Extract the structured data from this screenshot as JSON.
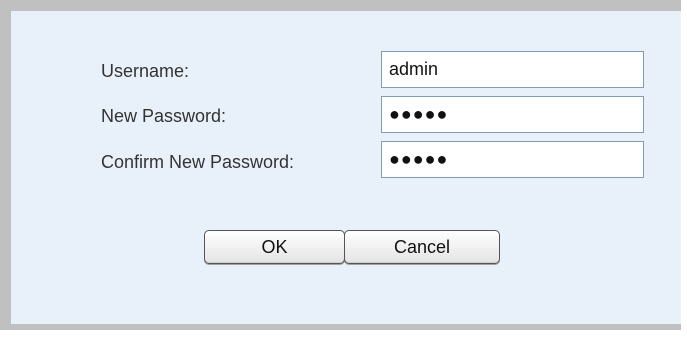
{
  "form": {
    "username_label": "Username:",
    "username_value": "admin",
    "new_password_label": "New Password:",
    "new_password_value": "●●●●●",
    "confirm_password_label": "Confirm New Password:",
    "confirm_password_value": "●●●●●"
  },
  "buttons": {
    "ok_label": "OK",
    "cancel_label": "Cancel"
  },
  "colors": {
    "panel_border": "#c0c0c0",
    "panel_background": "#e8f1fa",
    "label_text": "#333333",
    "field_border": "#7f9db9"
  }
}
